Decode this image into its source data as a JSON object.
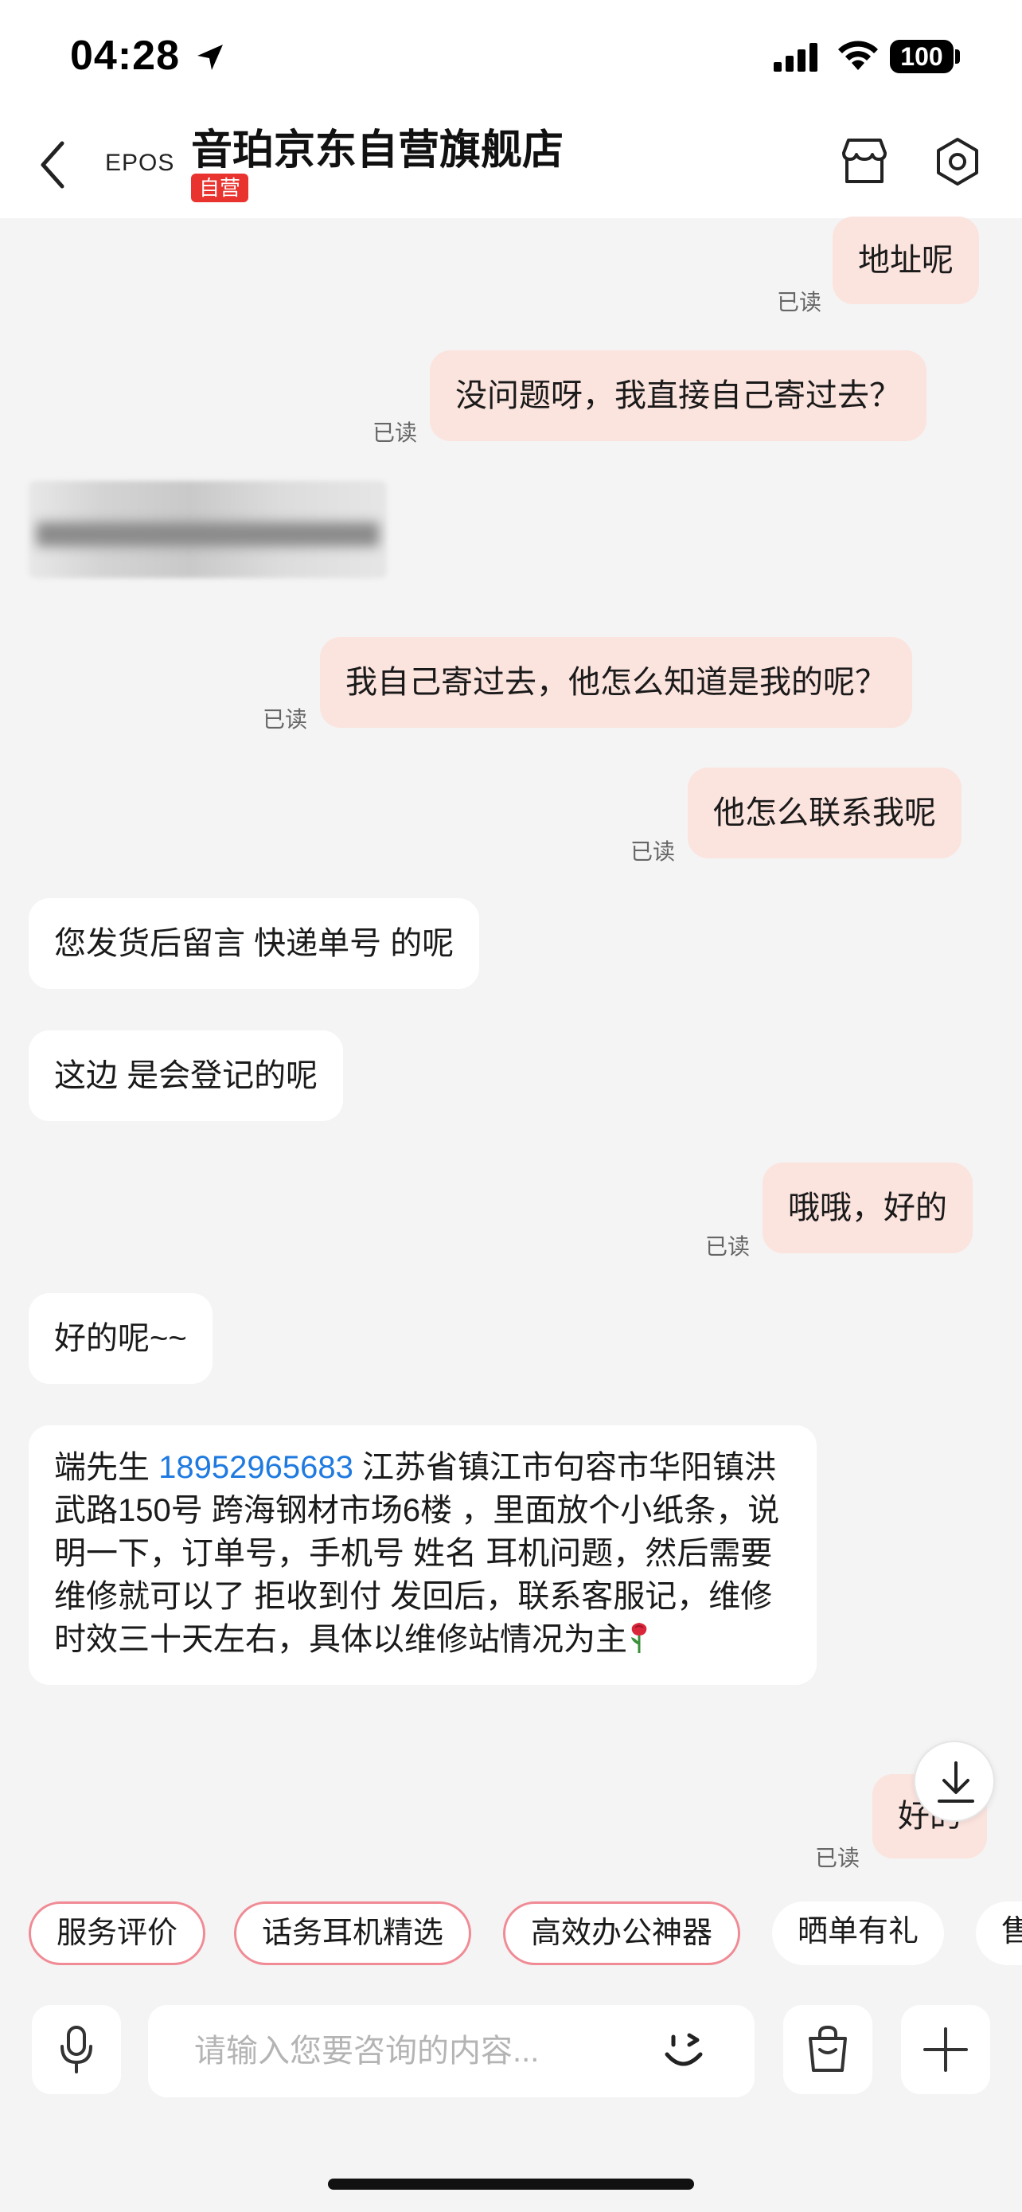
{
  "status_bar": {
    "time": "04:28",
    "battery": "100"
  },
  "header": {
    "brand_logo": "EPOS",
    "shop_name": "音珀京东自营旗舰店",
    "badge": "自营"
  },
  "messages": [
    {
      "dir": "out",
      "text": "地址呢",
      "status": "已读"
    },
    {
      "dir": "out",
      "text": "没问题呀，我直接自己寄过去？",
      "status": "已读"
    },
    {
      "dir": "in",
      "type": "image-blurred"
    },
    {
      "dir": "out",
      "text": "我自己寄过去，他怎么知道是我的呢？",
      "status": "已读"
    },
    {
      "dir": "out",
      "text": "他怎么联系我呢",
      "status": "已读"
    },
    {
      "dir": "in",
      "text": "您发货后留言 快递单号 的呢"
    },
    {
      "dir": "in",
      "text": "这边 是会登记的呢"
    },
    {
      "dir": "out",
      "text": "哦哦，好的",
      "status": "已读"
    },
    {
      "dir": "in",
      "text": "好的呢~~"
    },
    {
      "dir": "in",
      "text_prefix": "端先生 ",
      "phone": "18952965683",
      "text_suffix": " 江苏省镇江市句容市华阳镇洪武路150号 跨海钢材市场6楼 ，里面放个小纸条，说明一下，订单号，手机号   姓名 耳机问题，然后需要维修就可以了 拒收到付  发回后，联系客服记，维修时效三十天左右，具体以维修站情况为主"
    },
    {
      "dir": "out",
      "text": "好的",
      "status": "已读"
    }
  ],
  "quick_chips": [
    {
      "label": "服务评价",
      "outlined": true
    },
    {
      "label": "话务耳机精选",
      "outlined": true
    },
    {
      "label": "高效办公神器",
      "outlined": true
    },
    {
      "label": "晒单有礼",
      "outlined": false
    },
    {
      "label": "售",
      "outlined": false
    }
  ],
  "input": {
    "placeholder": "请输入您要咨询的内容...",
    "value": ""
  },
  "colors": {
    "outgoing_bubble": "#fbe3de",
    "incoming_bubble": "#ffffff",
    "badge_red": "#e8332f",
    "link_blue": "#1f7ae0",
    "chip_border": "#f08b95"
  },
  "icons": [
    "back-icon",
    "store-icon",
    "settings-icon",
    "location-arrow-icon",
    "signal-icon",
    "wifi-icon",
    "scroll-down-icon",
    "microphone-icon",
    "emoji-icon",
    "shopping-bag-icon",
    "plus-icon",
    "rose-icon"
  ]
}
